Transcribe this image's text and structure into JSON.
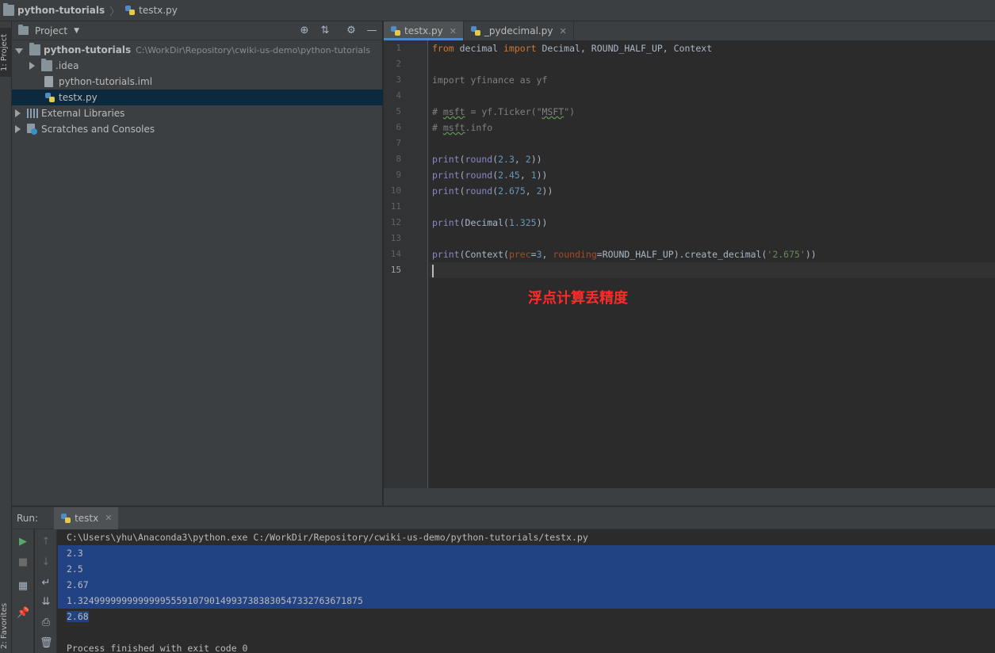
{
  "navbar": {
    "project": "python-tutorials",
    "file": "testx.py"
  },
  "left_stripe": {
    "project_tab": "1: Project",
    "favorites_tab": "2: Favorites"
  },
  "project_panel": {
    "title": "Project",
    "tree": [
      {
        "label": "python-tutorials",
        "hint": "C:\\WorkDir\\Repository\\cwiki-us-demo\\python-tutorials",
        "icon": "folder-icon"
      },
      {
        "label": ".idea",
        "icon": "folder-icon"
      },
      {
        "label": "python-tutorials.iml",
        "icon": "file-icon"
      },
      {
        "label": "testx.py",
        "icon": "python-file-icon",
        "selected": true
      },
      {
        "label": "External Libraries",
        "icon": "library-icon"
      },
      {
        "label": "Scratches and Consoles",
        "icon": "scratch-icon"
      }
    ]
  },
  "editor": {
    "tabs": [
      {
        "label": "testx.py",
        "active": true
      },
      {
        "label": "_pydecimal.py",
        "active": false
      }
    ],
    "line_numbers": [
      "1",
      "2",
      "3",
      "4",
      "5",
      "6",
      "7",
      "8",
      "9",
      "10",
      "11",
      "12",
      "13",
      "14",
      "15"
    ],
    "current_line": "15",
    "annotation": "浮点计算丢精度",
    "code": {
      "l1": [
        "from",
        " decimal ",
        "import",
        " Decimal, ROUND_HALF_UP, Context"
      ],
      "l3": "import yfinance as yf",
      "l5": [
        "# ",
        "msft",
        " = yf.Ticker(\"",
        "MSFT",
        "\")"
      ],
      "l6": [
        "# ",
        "msft",
        ".info"
      ],
      "l8": [
        "print",
        "(",
        "round",
        "(",
        "2.3",
        ", ",
        "2",
        "))"
      ],
      "l9": [
        "print",
        "(",
        "round",
        "(",
        "2.45",
        ", ",
        "1",
        "))"
      ],
      "l10": [
        "print",
        "(",
        "round",
        "(",
        "2.675",
        ", ",
        "2",
        "))"
      ],
      "l12": [
        "print",
        "(Decimal(",
        "1.325",
        "))"
      ],
      "l14": [
        "print",
        "(Context(",
        "prec",
        "=",
        "3",
        ", ",
        "rounding",
        "=ROUND_HALF_UP).create_decimal(",
        "'2.675'",
        "))"
      ]
    }
  },
  "run_panel": {
    "label": "Run:",
    "tab": "testx",
    "console": [
      "C:\\Users\\yhu\\Anaconda3\\python.exe C:/WorkDir/Repository/cwiki-us-demo/python-tutorials/testx.py",
      "2.3",
      "2.5",
      "2.67",
      "1.3249999999999999555910790149937383830547332763671875",
      "2.68",
      "",
      "Process finished with exit code 0"
    ]
  },
  "colors": {
    "keyword": "#cc7832",
    "number": "#6897bb",
    "builtin": "#8888c6",
    "string": "#6a8759",
    "selection": "#214283",
    "annotation": "#ff2a2a"
  }
}
